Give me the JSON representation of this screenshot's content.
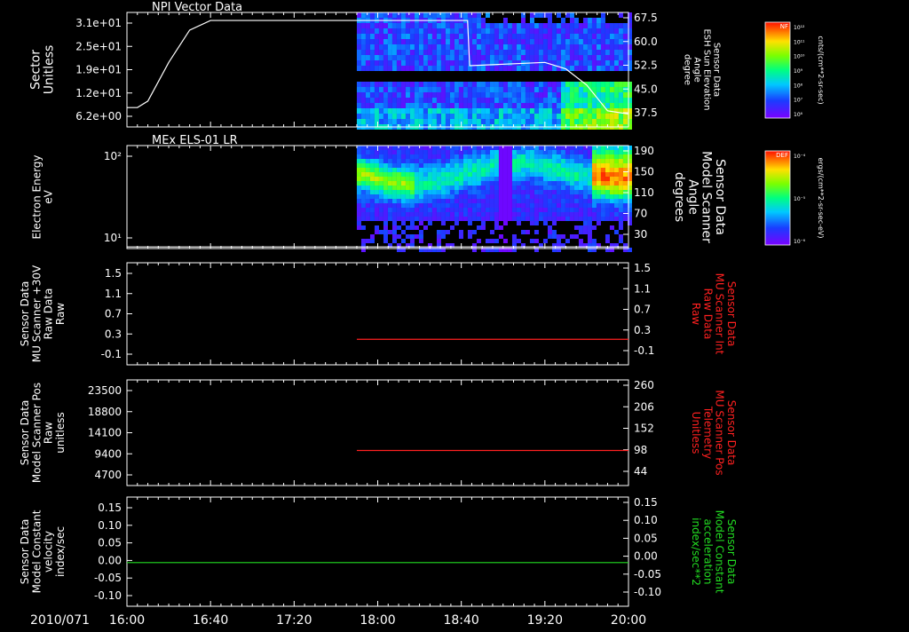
{
  "date_label": "2010/071",
  "time_ticks": [
    "16:00",
    "16:40",
    "17:20",
    "18:00",
    "18:40",
    "19:20",
    "20:00"
  ],
  "colorbars": [
    {
      "title": "NF",
      "units": "cnts/(cm**2-sr-sec)",
      "labels": [
        "10¹²",
        "10¹¹",
        "10¹⁰",
        "10⁹",
        "10⁸",
        "10⁷",
        "10⁶"
      ]
    },
    {
      "title": "DEF",
      "units": "ergs/(cm**2-sr-sec-eV)",
      "labels": [
        "10⁻⁴",
        "10⁻⁵",
        "10⁻⁶"
      ]
    }
  ],
  "colors": {
    "white": "#ffffff",
    "red": "#ff2020",
    "green": "#22dd22",
    "background": "#000000"
  },
  "chart_data": [
    {
      "type": "heatmap",
      "title": "NPI Vector Data",
      "ylabel_left": [
        "Sector",
        "Unitless"
      ],
      "left_ticks": [
        "3.1e+01",
        "2.5e+01",
        "1.9e+01",
        "1.2e+01",
        "6.2e+00"
      ],
      "ylabel_right": [
        "Sensor Data",
        "ESH Sun Elevation",
        "Angle",
        "degree"
      ],
      "right_ticks": [
        "67.5",
        "60.0",
        "52.5",
        "45.0",
        "37.5"
      ],
      "right_ylim": [
        32,
        67.5
      ],
      "data_start": "17:50",
      "line": {
        "times": [
          "16:00",
          "16:05",
          "16:10",
          "16:20",
          "16:30",
          "16:40",
          "18:43",
          "18:44",
          "19:20",
          "19:30",
          "19:40",
          "19:50",
          "20:00"
        ],
        "values": [
          38,
          38,
          40,
          52,
          62,
          65,
          65,
          51,
          52,
          50,
          45,
          37,
          36
        ]
      }
    },
    {
      "type": "heatmap",
      "title": "MEx ELS-01 LR",
      "ylabel_left": [
        "Electron Energy",
        "eV"
      ],
      "left_ticks": [
        "10²",
        "10¹"
      ],
      "ylabel_right": [
        "Sensor Data",
        "Model Scanner",
        "Angle",
        "degrees"
      ],
      "right_ticks": [
        "190",
        "150",
        "110",
        "70",
        "30"
      ],
      "right_ylim": [
        0,
        190
      ],
      "data_start": "17:50",
      "line": {
        "times": [
          "16:00",
          "20:00"
        ],
        "values": [
          3,
          3
        ]
      }
    },
    {
      "type": "line",
      "ylabel_left": [
        "Sensor Data",
        "MU Scanner +30V",
        "Raw Data",
        "Raw"
      ],
      "left_ticks": [
        "1.5",
        "1.1",
        "0.7",
        "0.3",
        "-0.1"
      ],
      "ylabel_right": [
        "Sensor Data",
        "MU Scanner Int",
        "Raw Data",
        "Raw"
      ],
      "right_ticks": [
        "1.5",
        "1.1",
        "0.7",
        "0.3",
        "-0.1"
      ],
      "ylim": [
        -0.5,
        1.5
      ],
      "series": [
        {
          "color": "red",
          "times": [
            "17:50",
            "20:00"
          ],
          "values": [
            0,
            0
          ]
        }
      ]
    },
    {
      "type": "line",
      "ylabel_left": [
        "Sensor Data",
        "Model Scanner Pos",
        "Raw",
        "unitless"
      ],
      "left_ticks": [
        "23500",
        "18800",
        "14100",
        "9400",
        "4700"
      ],
      "ylabel_right": [
        "Sensor Data",
        "MU Scanner Pos",
        "Telemetry",
        "Unitless"
      ],
      "right_ticks": [
        "260",
        "206",
        "152",
        "98",
        "44"
      ],
      "ylim": [
        0,
        23500
      ],
      "series": [
        {
          "color": "red",
          "times": [
            "17:50",
            "20:00"
          ],
          "values": [
            7800,
            7800
          ]
        }
      ]
    },
    {
      "type": "line",
      "ylabel_left": [
        "Sensor Data",
        "Model Constant",
        "velocity",
        "index/sec"
      ],
      "left_ticks": [
        "0.15",
        "0.10",
        "0.05",
        "0.00",
        "-0.05",
        "-0.10"
      ],
      "ylabel_right": [
        "Sensor Data",
        "Model Constant",
        "acceleration",
        "index/sec**2"
      ],
      "right_ticks": [
        "0.15",
        "0.10",
        "0.05",
        "0.00",
        "-0.05",
        "-0.10"
      ],
      "ylim": [
        -0.1,
        0.15
      ],
      "series": [
        {
          "color": "green",
          "times": [
            "16:00",
            "20:00"
          ],
          "values": [
            0,
            0
          ]
        }
      ]
    }
  ]
}
